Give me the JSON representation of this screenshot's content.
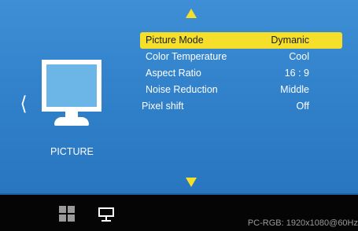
{
  "menu": {
    "items": [
      {
        "label": "Picture Mode",
        "value": "Dymanic",
        "selected": true
      },
      {
        "label": "Color Temperature",
        "value": "Cool"
      },
      {
        "label": "Aspect Ratio",
        "value": "16 : 9"
      },
      {
        "label": "Noise Reduction",
        "value": "Middle"
      },
      {
        "label": "Pixel shift",
        "value": "Off"
      }
    ]
  },
  "category": {
    "label": "PICTURE",
    "icon": "monitor-icon"
  },
  "nav": {
    "left_arrow": "❬",
    "up_arrow_icon": "triangle-up-icon",
    "down_arrow_icon": "triangle-down-icon"
  },
  "taskbar": {
    "icons": [
      "grid-icon",
      "display-icon"
    ],
    "status": "PC-RGB: 1920x1080@60Hz"
  },
  "colors": {
    "background": "#3f8fd6",
    "highlight": "#f5df2a",
    "taskbar": "#050505"
  }
}
